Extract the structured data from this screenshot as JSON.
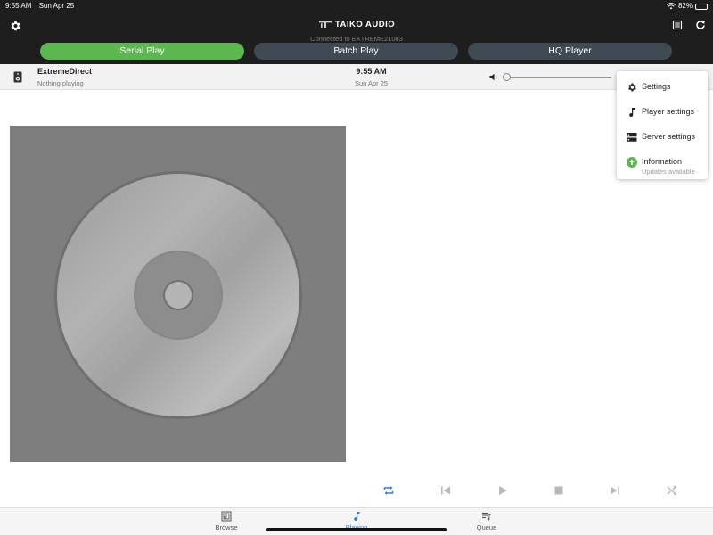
{
  "status_bar": {
    "time": "9:55 AM",
    "date": "Sun Apr 25",
    "battery": "82%",
    "battery_level": 0.82
  },
  "header": {
    "brand": "TAIKO AUDIO",
    "connection": "Connected to EXTREME21083",
    "icons": [
      "gear-icon",
      "list-icon",
      "refresh-icon"
    ]
  },
  "tabs": [
    {
      "label": "Serial Play",
      "active": true
    },
    {
      "label": "Batch Play",
      "active": false
    },
    {
      "label": "HQ Player",
      "active": false
    }
  ],
  "now_playing": {
    "device": "ExtremeDirect",
    "status": "Nothing playing",
    "time": "9:55 AM",
    "date": "Sun Apr 25",
    "volume_level": 0.0
  },
  "menu": {
    "items": [
      {
        "label": "Settings",
        "icon": "gear-icon"
      },
      {
        "label": "Player settings",
        "icon": "music-note-icon"
      },
      {
        "label": "Server settings",
        "icon": "server-icon"
      },
      {
        "label": "Information",
        "sublabel": "Updates available",
        "icon": "upload-icon"
      }
    ]
  },
  "controls": [
    "repeat-icon",
    "previous-icon",
    "play-icon",
    "stop-icon",
    "next-icon",
    "shuffle-icon"
  ],
  "bottom_nav": [
    {
      "label": "Browse",
      "icon": "browse-icon",
      "active": false
    },
    {
      "label": "Playing",
      "icon": "music-note-icon",
      "active": true
    },
    {
      "label": "Queue",
      "icon": "queue-icon",
      "active": false
    }
  ],
  "colors": {
    "accent_green": "#5bb84e",
    "tab_inactive": "#3f4a54",
    "header_bg": "#1e1e1e",
    "active_blue": "#3a7bd5"
  }
}
